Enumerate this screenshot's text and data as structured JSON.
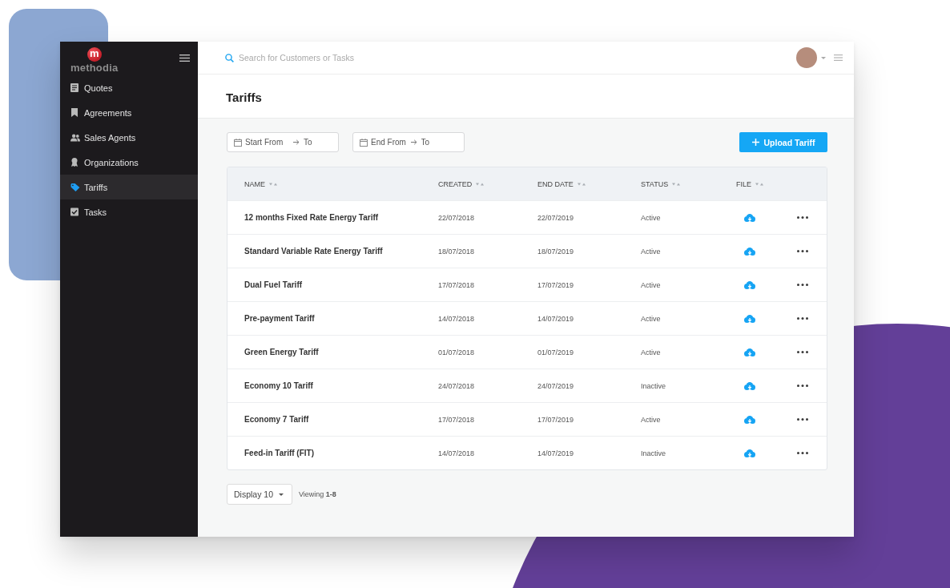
{
  "sidebar": {
    "logo": {
      "mark": "m",
      "wordmark": "methodia"
    },
    "items": [
      {
        "label": "Quotes",
        "selected": false
      },
      {
        "label": "Agreements",
        "selected": false
      },
      {
        "label": "Sales Agents",
        "selected": false
      },
      {
        "label": "Organizations",
        "selected": false
      },
      {
        "label": "Tariffs",
        "selected": true
      },
      {
        "label": "Tasks",
        "selected": false
      }
    ]
  },
  "topbar": {
    "search": {
      "placeholder": "Search for Customers or Tasks"
    }
  },
  "page": {
    "title": "Tariffs"
  },
  "filters": [
    {
      "from": {
        "placeholder": "Start From"
      },
      "to": {
        "placeholder": "To"
      }
    },
    {
      "from": {
        "placeholder": "End From"
      },
      "to": {
        "placeholder": "To"
      }
    }
  ],
  "upload_button": {
    "label": "Upload Tariff"
  },
  "table": {
    "columns": [
      "NAME",
      "CREATED",
      "END DATE",
      "STATUS",
      "FILE"
    ],
    "rows": [
      {
        "name": "12 months Fixed Rate Energy Tariff",
        "created": "22/07/2018",
        "end_date": "22/07/2019",
        "status": "Active"
      },
      {
        "name": "Standard Variable Rate Energy Tariff",
        "created": "18/07/2018",
        "end_date": "18/07/2019",
        "status": "Active"
      },
      {
        "name": "Dual Fuel Tariff",
        "created": "17/07/2018",
        "end_date": "17/07/2019",
        "status": "Active"
      },
      {
        "name": "Pre-payment Tariff",
        "created": "14/07/2018",
        "end_date": "14/07/2019",
        "status": "Active"
      },
      {
        "name": "Green Energy Tariff",
        "created": "01/07/2018",
        "end_date": "01/07/2019",
        "status": "Active"
      },
      {
        "name": "Economy 10 Tariff",
        "created": "24/07/2018",
        "end_date": "24/07/2019",
        "status": "Inactive"
      },
      {
        "name": "Economy 7 Tariff",
        "created": "17/07/2018",
        "end_date": "17/07/2019",
        "status": "Active"
      },
      {
        "name": "Feed-in Tariff (FIT)",
        "created": "14/07/2018",
        "end_date": "14/07/2019",
        "status": "Inactive"
      }
    ]
  },
  "footer": {
    "page_size": {
      "value": "Display 10"
    },
    "viewing": "Viewing **1-8**"
  }
}
